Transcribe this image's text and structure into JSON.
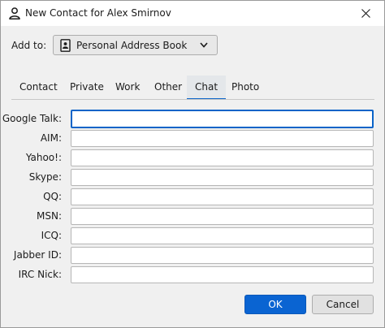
{
  "window": {
    "title": "New Contact for Alex Smirnov"
  },
  "add_to": {
    "label": "Add to:",
    "selected": "Personal Address Book"
  },
  "tabs": [
    {
      "label": "Contact"
    },
    {
      "label": "Private"
    },
    {
      "label": "Work"
    },
    {
      "label": "Other"
    },
    {
      "label": "Chat",
      "selected": true
    },
    {
      "label": "Photo"
    }
  ],
  "chat_fields": [
    {
      "label": "Google Talk:",
      "value": ""
    },
    {
      "label": "AIM:",
      "value": ""
    },
    {
      "label": "Yahoo!:",
      "value": ""
    },
    {
      "label": "Skype:",
      "value": ""
    },
    {
      "label": "QQ:",
      "value": ""
    },
    {
      "label": "MSN:",
      "value": ""
    },
    {
      "label": "ICQ:",
      "value": ""
    },
    {
      "label": "Jabber ID:",
      "value": ""
    },
    {
      "label": "IRC Nick:",
      "value": ""
    }
  ],
  "buttons": {
    "ok": "OK",
    "cancel": "Cancel"
  },
  "colors": {
    "accent": "#0a64d2",
    "window_bg": "#f0f0f0"
  },
  "icons": {
    "title": "person-icon",
    "address_book": "address-book-icon",
    "dropdown": "chevron-down-icon",
    "close": "close-icon"
  }
}
